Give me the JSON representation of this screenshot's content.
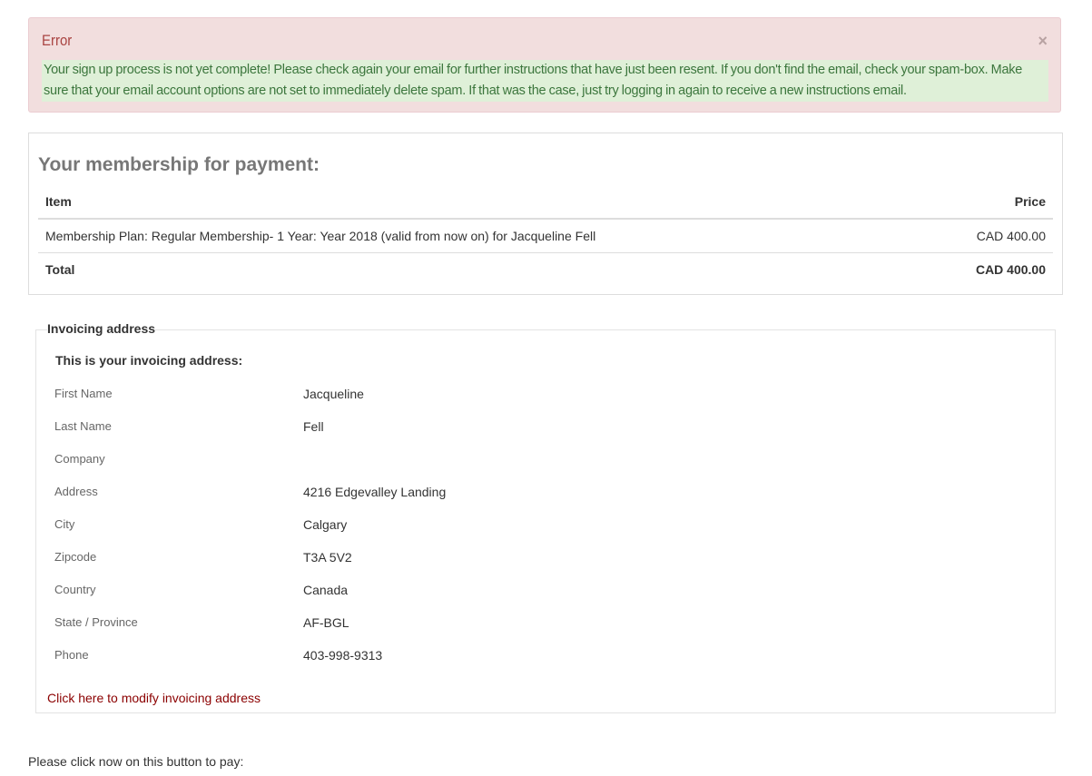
{
  "alert": {
    "title": "Error",
    "close_symbol": "×",
    "message": "Your sign up process is not yet complete! Please check again your email for further instructions that have just been resent. If you don't find the email, check your spam-box. Make sure that your email account options are not set to immediately delete spam. If that was the case, just try logging in again to receive a new instructions email."
  },
  "membership": {
    "title": "Your membership for payment:",
    "columns": {
      "item": "Item",
      "price": "Price"
    },
    "rows": [
      {
        "item": "Membership Plan: Regular Membership- 1 Year: Year 2018 (valid from now on) for Jacqueline Fell",
        "price": "CAD 400.00"
      }
    ],
    "total": {
      "label": "Total",
      "price": "CAD 400.00"
    }
  },
  "invoicing": {
    "legend": "Invoicing address",
    "subtitle": "This is your invoicing address:",
    "fields": [
      {
        "label": "First Name",
        "value": "Jacqueline"
      },
      {
        "label": "Last Name",
        "value": "Fell"
      },
      {
        "label": "Company",
        "value": ""
      },
      {
        "label": "Address",
        "value": "4216 Edgevalley Landing"
      },
      {
        "label": "City",
        "value": "Calgary"
      },
      {
        "label": "Zipcode",
        "value": "T3A 5V2"
      },
      {
        "label": "Country",
        "value": "Canada"
      },
      {
        "label": "State / Province",
        "value": "AF-BGL"
      },
      {
        "label": "Phone",
        "value": "403-998-9313"
      }
    ],
    "modify_link": "Click here to modify invoicing address"
  },
  "pay_note": "Please click now on this button to pay:"
}
